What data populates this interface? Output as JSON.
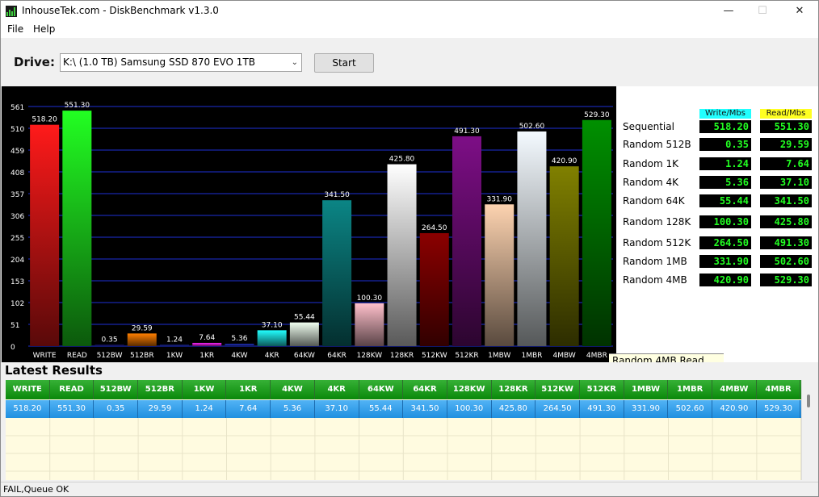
{
  "window": {
    "title": "InhouseTek.com - DiskBenchmark v1.3.0",
    "minimize": "—",
    "maximize": "☐",
    "close": "✕"
  },
  "menu": {
    "file": "File",
    "help": "Help"
  },
  "toolbar": {
    "drive_label": "Drive:",
    "drive_value": "K:\\ (1.0 TB) Samsung SSD 870 EVO 1TB",
    "start_label": "Start"
  },
  "chart_data": {
    "type": "bar",
    "categories": [
      "WRITE",
      "READ",
      "512BW",
      "512BR",
      "1KW",
      "1KR",
      "4KW",
      "4KR",
      "64KW",
      "64KR",
      "128KW",
      "128KR",
      "512KW",
      "512KR",
      "1MBW",
      "1MBR",
      "4MBW",
      "4MBR"
    ],
    "values": [
      518.2,
      551.3,
      0.35,
      29.59,
      1.24,
      7.64,
      5.36,
      37.1,
      55.44,
      341.5,
      100.3,
      425.8,
      264.5,
      491.3,
      331.9,
      502.6,
      420.9,
      529.3
    ],
    "value_labels": [
      "518.20",
      "551.30",
      "0.35",
      "29.59",
      "1.24",
      "7.64",
      "5.36",
      "37.10",
      "55.44",
      "341.50",
      "100.30",
      "425.80",
      "264.50",
      "491.30",
      "331.90",
      "502.60",
      "420.90",
      "529.30"
    ],
    "colors": [
      "#ff1a1a",
      "#22ff22",
      "#2222aa",
      "#ff7f00",
      "#2233cc",
      "#ff22ff",
      "#2233cc",
      "#22ffff",
      "#f0fff0",
      "#0b8585",
      "#ffc0cb",
      "#ffffff",
      "#8b0000",
      "#7d0e86",
      "#fdd3b0",
      "#f4faff",
      "#808000",
      "#009000"
    ],
    "y_ticks": [
      "0",
      "51",
      "102",
      "153",
      "204",
      "255",
      "306",
      "357",
      "408",
      "459",
      "510",
      "561"
    ],
    "ylim": [
      0,
      561
    ],
    "grid": true,
    "background": "#000000",
    "gridline_color": "#1e2fd6"
  },
  "results": {
    "write_header": "Write/Mbs",
    "read_header": "Read/Mbs",
    "write_header_color": "#22ffff",
    "read_header_color": "#ffff22",
    "rows": [
      {
        "label": "Sequential",
        "write": "518.20",
        "read": "551.30"
      },
      {
        "label": "Random 512B",
        "write": "0.35",
        "read": "29.59"
      },
      {
        "label": "Random 1K",
        "write": "1.24",
        "read": "7.64"
      },
      {
        "label": "Random 4K",
        "write": "5.36",
        "read": "37.10"
      },
      {
        "label": "Random 64K",
        "write": "55.44",
        "read": "341.50"
      },
      {
        "label": "Random 128K",
        "write": "100.30",
        "read": "425.80"
      },
      {
        "label": "Random 512K",
        "write": "264.50",
        "read": "491.30"
      },
      {
        "label": "Random 1MB",
        "write": "331.90",
        "read": "502.60"
      },
      {
        "label": "Random 4MB",
        "write": "420.90",
        "read": "529.30"
      }
    ]
  },
  "tooltip": {
    "text": "Random 4MB Read"
  },
  "latest": {
    "title": "Latest Results",
    "columns": [
      "WRITE",
      "READ",
      "512BW",
      "512BR",
      "1KW",
      "1KR",
      "4KW",
      "4KR",
      "64KW",
      "64KR",
      "128KW",
      "128KR",
      "512KW",
      "512KR",
      "1MBW",
      "1MBR",
      "4MBW",
      "4MBR"
    ],
    "row": [
      "518.20",
      "551.30",
      "0.35",
      "29.59",
      "1.24",
      "7.64",
      "5.36",
      "37.10",
      "55.44",
      "341.50",
      "100.30",
      "425.80",
      "264.50",
      "491.30",
      "331.90",
      "502.60",
      "420.90",
      "529.30"
    ]
  },
  "status": {
    "text": "FAIL,Queue OK"
  }
}
